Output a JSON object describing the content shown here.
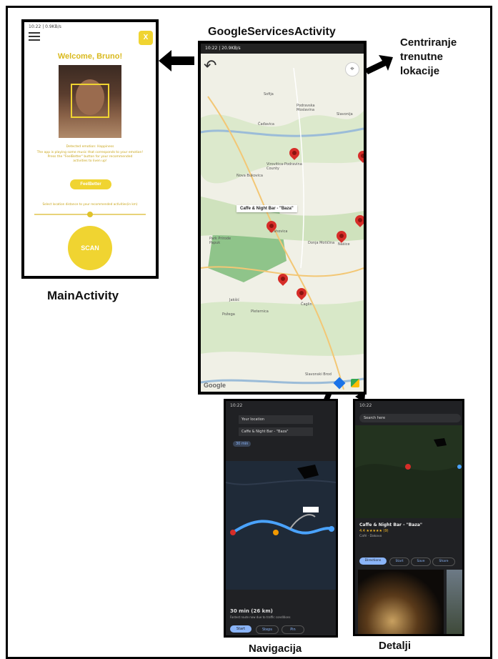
{
  "labels": {
    "google_services": "GoogleServicesActivity",
    "center_line1": "Centriranje",
    "center_line2": "trenutne",
    "center_line3": "lokacije",
    "main_activity": "MainActivity",
    "navigacija": "Navigacija",
    "detalji": "Detalji"
  },
  "main": {
    "welcome": "Welcome, Bruno!",
    "close_label": "X",
    "detected": "Detected emotion: Happiness",
    "info_line1": "The app is playing some music that corresponds to your emotion!",
    "info_line2": "Press the \"FeelBetter\" button for your recommended",
    "info_line3": "activities to liven up!",
    "feelbetter_label": "FeelBetter",
    "distance_label": "Select location distance to your recommended activities(in km)",
    "slider_value": 0.5,
    "scan_label": "SCAN"
  },
  "map": {
    "status_time": "10:22 | 20.9KB/s",
    "info_label": "Caffe & Night Bar - \"Baza\"",
    "places": [
      "Sofija",
      "Podravska Moslavina",
      "Slavonija",
      "Čađavica",
      "Virovitica-Podravina County",
      "Nova Bukovica",
      "Orahovica",
      "Park Prirode Papuk",
      "Donja Motičina",
      "Našice",
      "Jakšić",
      "Pleternica",
      "Slavonski Brod",
      "Čaglin",
      "Požega"
    ],
    "google": "Google"
  },
  "nav": {
    "from": "Your location",
    "to": "Caffe & Night Bar - \"Baza\"",
    "mode": "30 min",
    "eta": "30 min (26 km)",
    "eta_note": "Fastest route now due to traffic conditions",
    "start_label": "Start",
    "steps_label": "Steps",
    "pin_label": "Pin"
  },
  "details": {
    "search": "Search here",
    "name": "Caffe & Night Bar - \"Baza\"",
    "rating": "4.4 ★★★★★ (9)",
    "line2": "Café · Dakovo",
    "directions_label": "Directions",
    "start_label": "Start",
    "save_label": "Save",
    "share_label": "Share"
  }
}
